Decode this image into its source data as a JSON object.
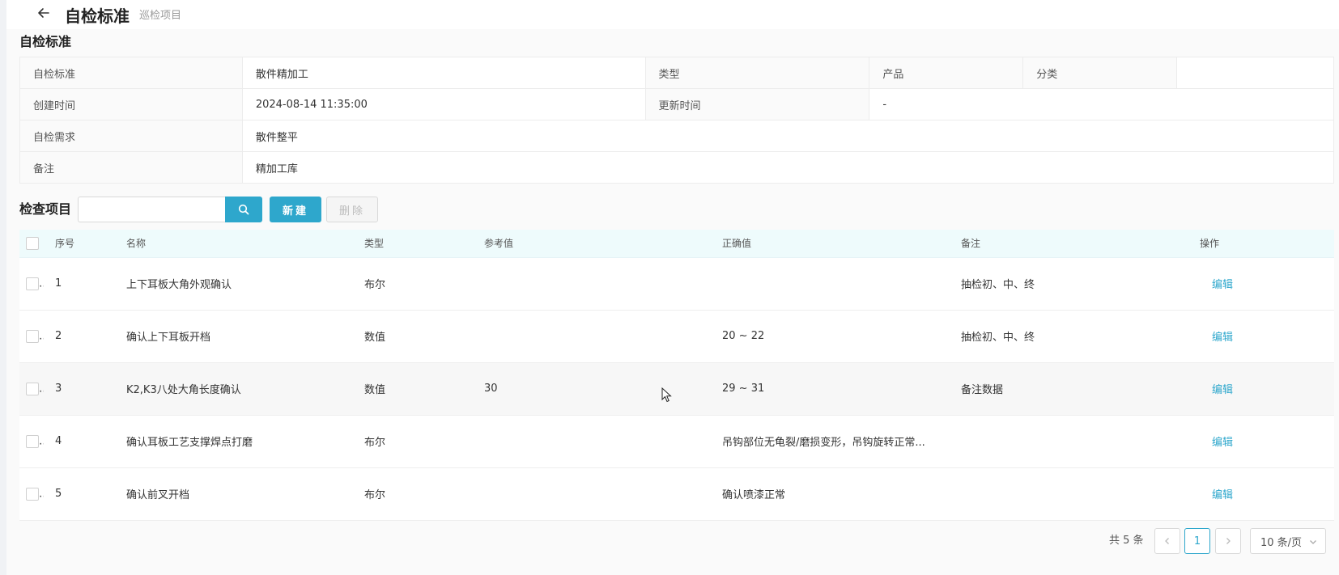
{
  "header": {
    "title": "自检标准",
    "subtitle": "巡检项目"
  },
  "info": {
    "section_title": "自检标准",
    "rows": [
      [
        {
          "label": "自检标准",
          "value": "散件精加工"
        },
        {
          "label": "类型",
          "value": ""
        },
        {
          "label": "产品",
          "value": ""
        },
        {
          "label": "分类",
          "value": ""
        }
      ],
      [
        {
          "label": "创建时间",
          "value": "2024-08-14 11:35:00"
        },
        {
          "label": "更新时间",
          "value": "-"
        }
      ],
      [
        {
          "label": "自检需求",
          "value": "散件整平"
        }
      ],
      [
        {
          "label": "备注",
          "value": "精加工库"
        }
      ]
    ]
  },
  "items": {
    "section_title": "检查项目",
    "search_value": "",
    "new_label": "新建",
    "delete_label": "删除",
    "columns": [
      "序号",
      "名称",
      "类型",
      "参考值",
      "正确值",
      "备注",
      "操作"
    ],
    "rows": [
      {
        "no": "1",
        "name": "上下耳板大角外观确认",
        "type": "布尔",
        "ref": "",
        "correct": "",
        "note": "抽检初、中、终",
        "action": "编辑"
      },
      {
        "no": "2",
        "name": "确认上下耳板开档",
        "type": "数值",
        "ref": "",
        "correct": "20 ~ 22",
        "note": "抽检初、中、终",
        "action": "编辑"
      },
      {
        "no": "3",
        "name": "K2,K3八处大角长度确认",
        "type": "数值",
        "ref": "30",
        "correct": "29 ~ 31",
        "note": "备注数据",
        "action": "编辑"
      },
      {
        "no": "4",
        "name": "确认耳板工艺支撑焊点打磨",
        "type": "布尔",
        "ref": "",
        "correct": "吊钩部位无龟裂/磨损变形，吊钩旋转正常...",
        "note": "",
        "action": "编辑"
      },
      {
        "no": "5",
        "name": "确认前叉开档",
        "type": "布尔",
        "ref": "",
        "correct": "确认喷漆正常",
        "note": "",
        "action": "编辑"
      }
    ]
  },
  "pagination": {
    "total_text": "共 5 条",
    "current_page": "1",
    "page_size": "10 条/页"
  },
  "colors": {
    "accent": "#2ea7cc",
    "header_bg": "#eefbfc"
  }
}
